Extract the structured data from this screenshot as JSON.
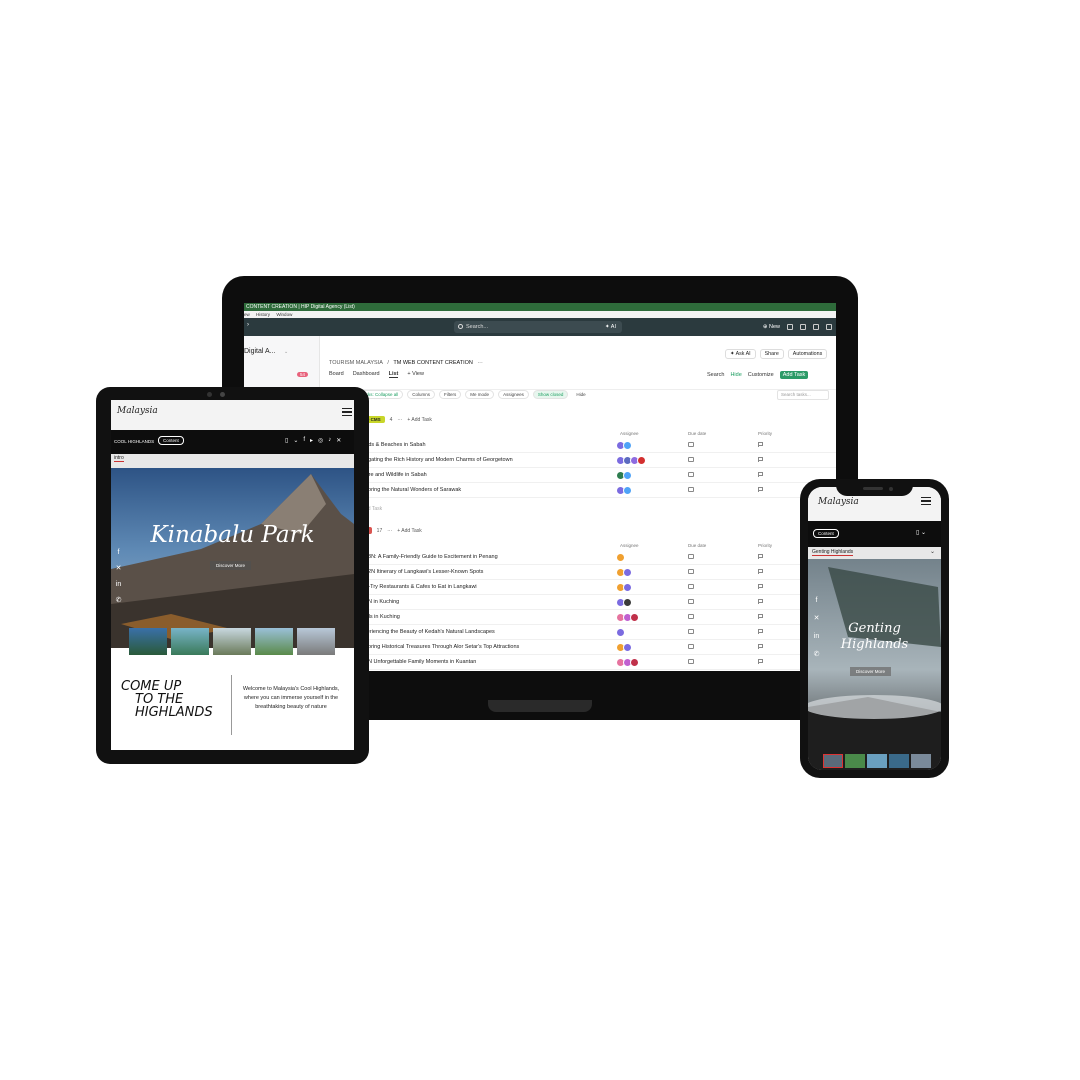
{
  "laptop": {
    "window_title": "CONTENT CREATION | HIP Digital Agency (List)",
    "menu": [
      "ew",
      "History",
      "Window"
    ],
    "search_placeholder": "Search...",
    "search_ai": "AI",
    "top_right_new": "New",
    "workspace": "Digital A...",
    "badge_count": "54",
    "breadcrumb_1": "TOURISM MALAYSIA",
    "breadcrumb_sep": "/",
    "breadcrumb_2": "TM WEB CONTENT CREATION",
    "ask_ai": "Ask AI",
    "share": "Share",
    "automations": "Automations",
    "views": [
      "Board",
      "Dashboard",
      "List",
      "+ View"
    ],
    "search_btn": "Search",
    "hide_btn": "Hide",
    "customize_btn": "Customize",
    "add_task_btn": "Add Task",
    "subtasks": "Subtasks: Collapse all",
    "columns": "Columns",
    "filters": "Filters",
    "me_mode": "Me mode",
    "assignees": "Assignees",
    "show_closed": "Show closed",
    "hide": "Hide",
    "search_tasks": "Search tasks...",
    "group1": {
      "tag": "Y TO CMS",
      "count": "4",
      "add": "Add Task",
      "color": "#c8d629"
    },
    "group2": {
      "tag": "VAL",
      "count": "17",
      "add": "Add Task",
      "color": "#d9534f"
    },
    "col_assignee": "Assignee",
    "col_due": "Due date",
    "col_priority": "Priority",
    "add_task_row": "dd Task",
    "tasks_group1": [
      "lands & Beaches in Sabah",
      "avigating the Rich History and Modern Charms of Georgetown",
      "ature and Wildlife in Sabah",
      "xploring the Natural Wonders of Sarawak"
    ],
    "tasks_group2": [
      "3D3N: A Family-Friendly Guide to Excitement in Penang",
      "3D2N Itinerary of Langkawi's Lesser-Known Spots",
      "ust-Try Restaurants & Cafes to Eat in Langkawi",
      "D3N in Kuching",
      "otels in Kuching",
      "xperiencing the Beauty of Kedah's Natural Landscapes",
      "xploring Historical Treasures Through Alor Setar's Top Attractions",
      "D2N Unforgettable Family Moments in Kuantan"
    ]
  },
  "tablet": {
    "logo": "Malaysia",
    "nav_left": "COOL HIGHLANDS",
    "nav_btn": "Content",
    "tag": "intro",
    "hero_title": "Kinabalu Park",
    "hero_btn": "Discover More",
    "come_up_1": "COME UP",
    "come_up_2": "TO THE",
    "come_up_3": "HIGHLANDS",
    "welcome": "Welcome to Malaysia's Cool Highlands, where you can immerse yourself in the breathtaking beauty of nature"
  },
  "phone": {
    "logo": "Malaysia",
    "nav_btn": "Content",
    "tag": "Genting Highlands",
    "hero_title_1": "Genting",
    "hero_title_2": "Highlands",
    "hero_btn": "Discover More"
  }
}
